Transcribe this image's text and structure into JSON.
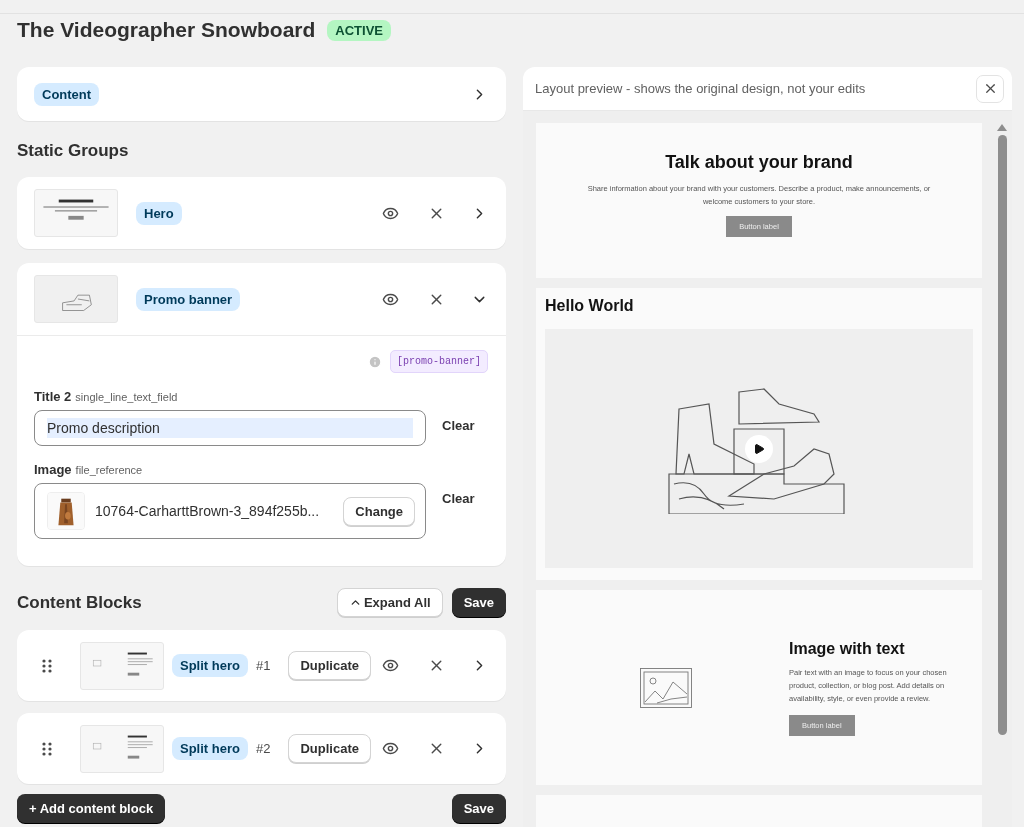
{
  "title": "The Videographer Snowboard",
  "status": "ACTIVE",
  "content_section": {
    "label": "Content"
  },
  "static_groups": {
    "heading": "Static Groups",
    "groups": [
      {
        "label": "Hero",
        "expanded": false
      },
      {
        "label": "Promo banner",
        "expanded": true,
        "tag": "[promo-banner]",
        "fields": [
          {
            "kind": "text",
            "label": "Title 2",
            "type": "single_line_text_field",
            "value": "Promo description",
            "highlighted": true,
            "action": "Clear"
          },
          {
            "kind": "file",
            "label": "Image",
            "type": "file_reference",
            "file_name": "10764-CarharttBrown-3_894f255b...",
            "change": "Change",
            "action": "Clear"
          }
        ]
      }
    ]
  },
  "content_blocks": {
    "heading": "Content Blocks",
    "expand_all": "Expand All",
    "save": "Save",
    "blocks": [
      {
        "label": "Split hero",
        "number": "#1",
        "duplicate": "Duplicate"
      },
      {
        "label": "Split hero",
        "number": "#2",
        "duplicate": "Duplicate"
      }
    ],
    "add": "+ Add content block",
    "save_bottom": "Save"
  },
  "preview": {
    "title": "Layout preview - shows the original design, not your edits",
    "sections": [
      {
        "kind": "banner",
        "heading": "Talk about your brand",
        "text": "Share information about your brand with your customers. Describe a product, make announcements, or welcome customers to your store.",
        "button": "Button label"
      },
      {
        "kind": "video",
        "heading": "Hello World"
      },
      {
        "kind": "image_text",
        "heading": "Image with text",
        "text": "Pair text with an image to focus on your chosen product, collection, or blog post. Add details on availability, style, or even provide a review.",
        "button": "Button label"
      },
      {
        "kind": "blank"
      }
    ]
  }
}
